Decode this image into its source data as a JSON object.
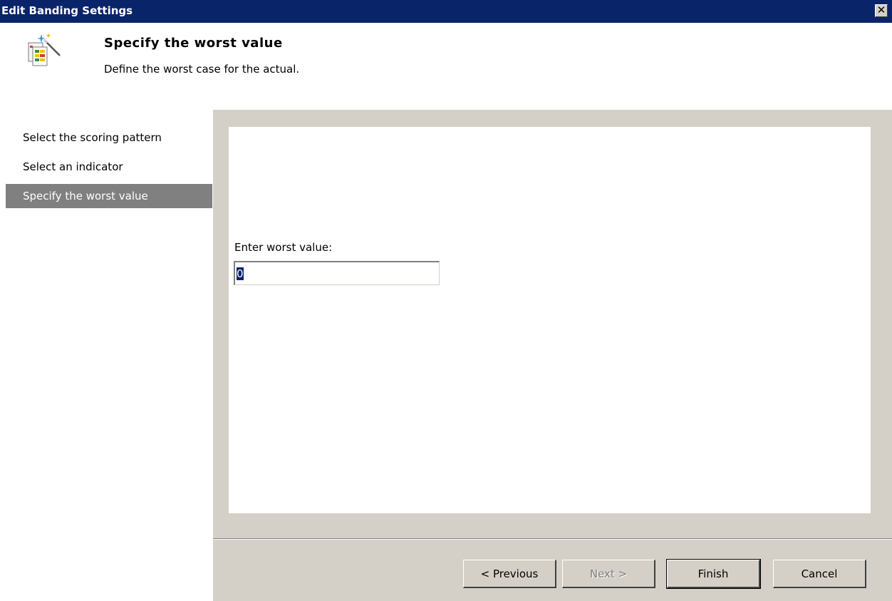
{
  "window": {
    "title": "Edit Banding Settings",
    "close_glyph": "✕"
  },
  "header": {
    "heading": "Specify the worst value",
    "description": "Define the worst case for the actual.",
    "icon": "banding-wizard-icon"
  },
  "steps": [
    {
      "label": "Select the scoring pattern",
      "active": false
    },
    {
      "label": "Select an indicator",
      "active": false
    },
    {
      "label": "Specify the worst value",
      "active": true
    }
  ],
  "form": {
    "label": "Enter worst value:",
    "value": "0"
  },
  "buttons": {
    "previous": "< Previous",
    "next": "Next >",
    "finish": "Finish",
    "cancel": "Cancel"
  },
  "colors": {
    "titlebar": "#0a246a",
    "panel": "#d4d0c8",
    "active_step": "#808080"
  }
}
